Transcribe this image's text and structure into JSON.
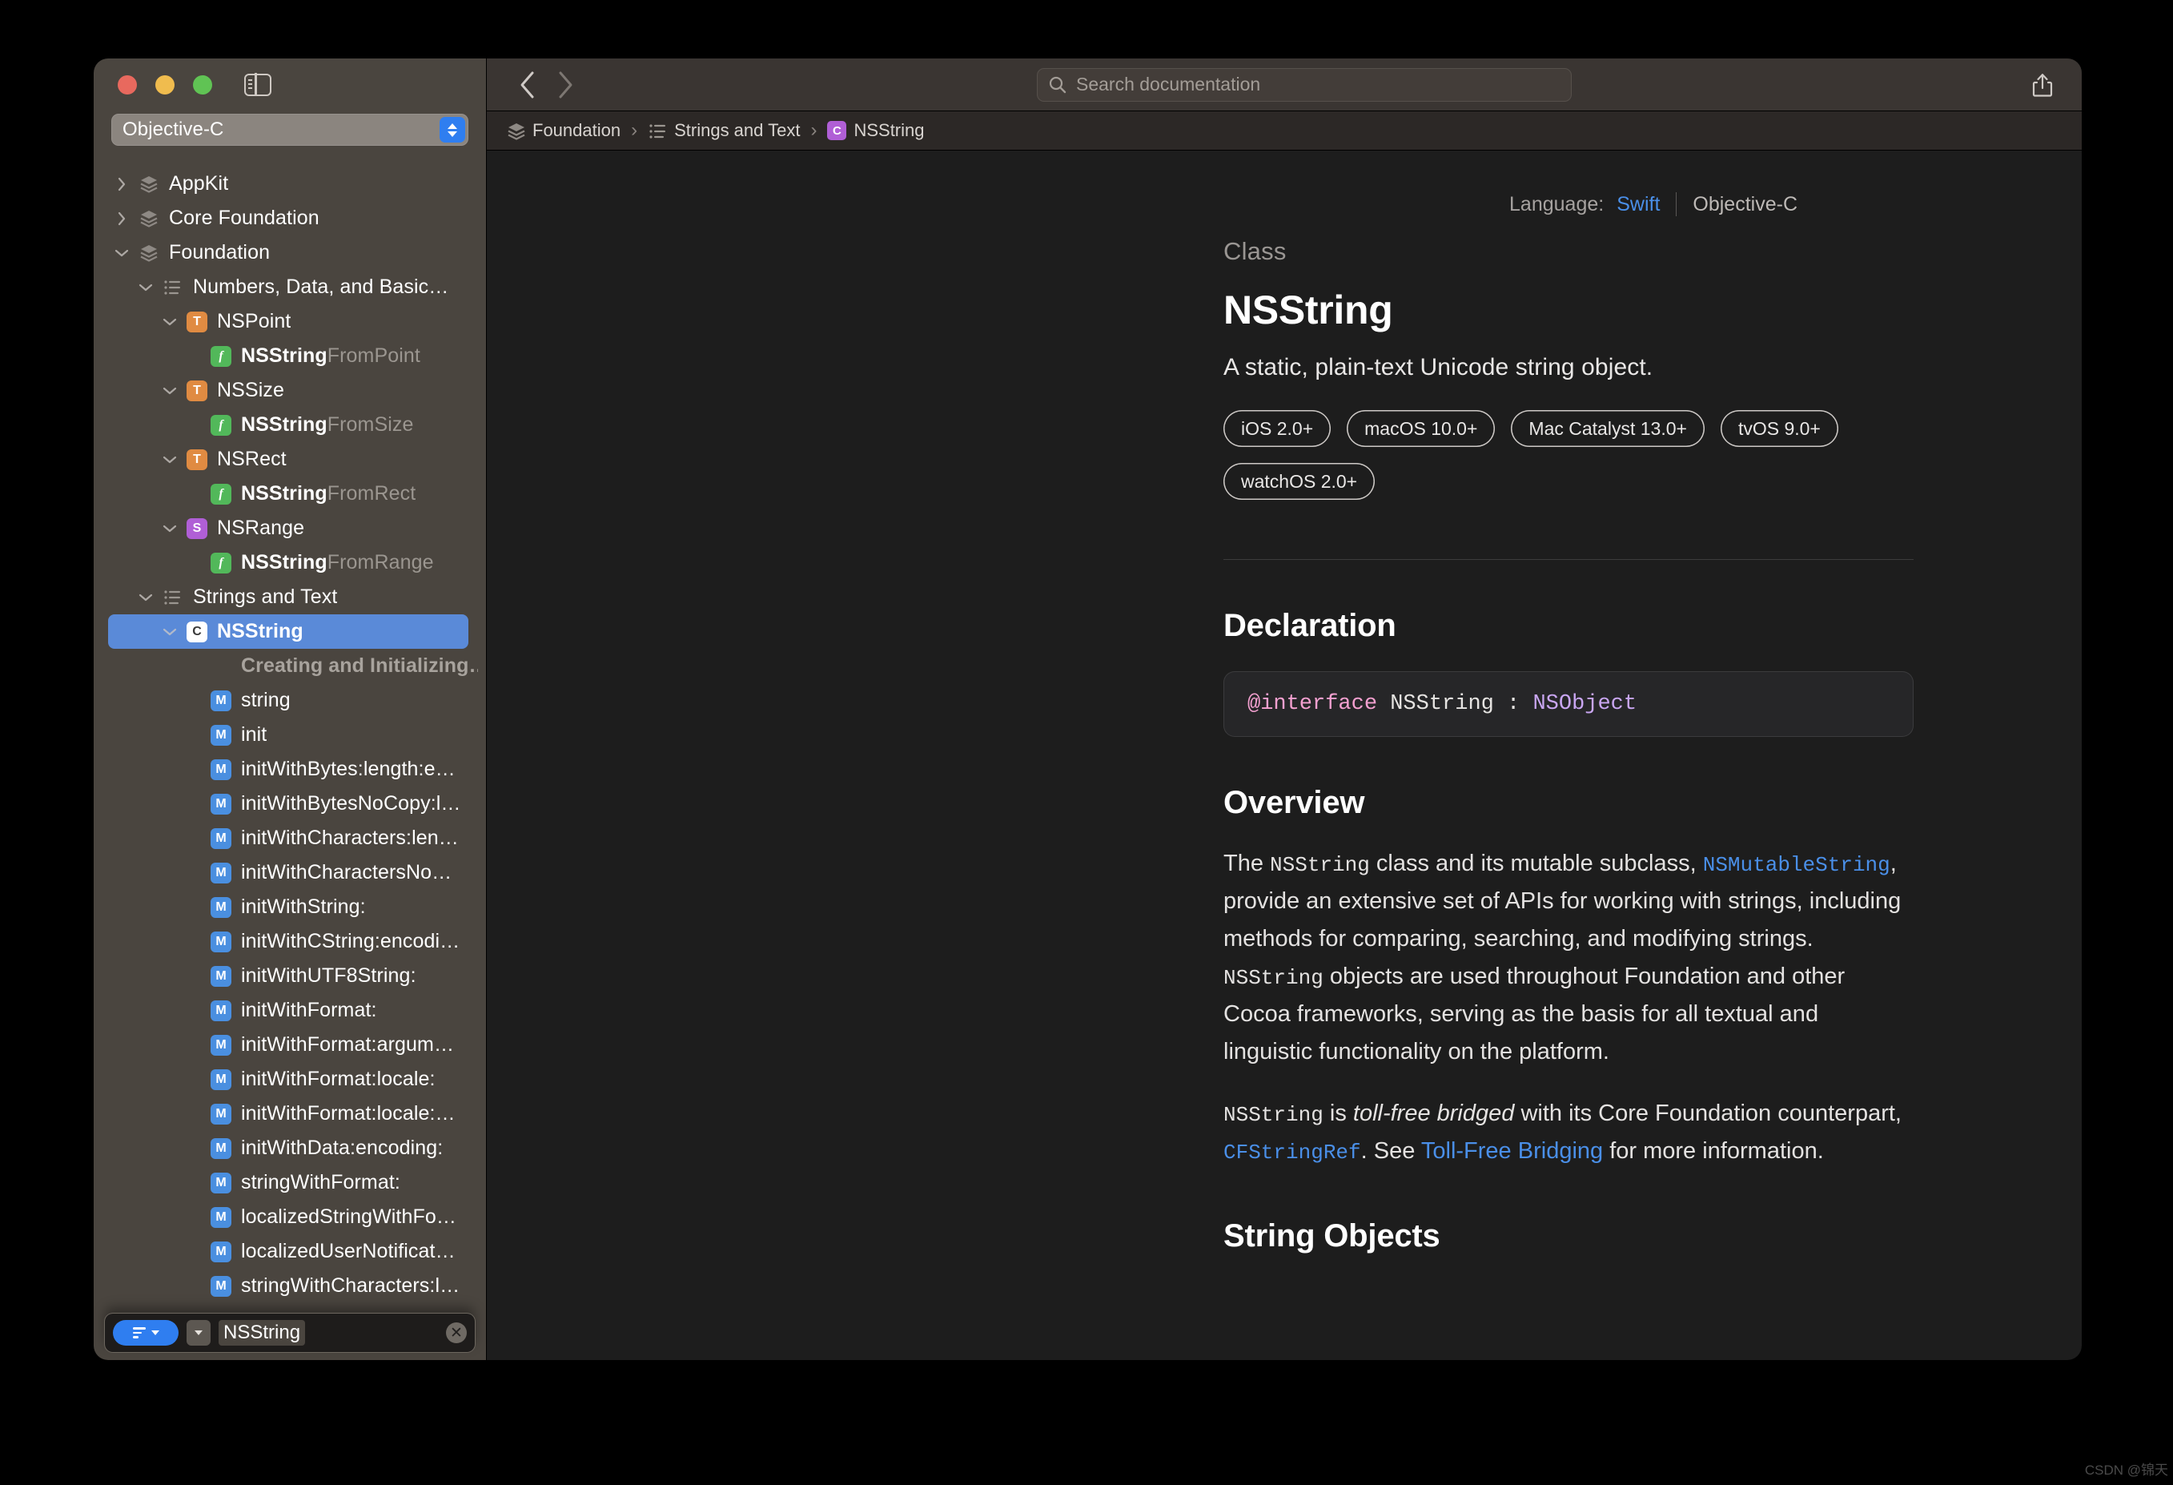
{
  "window": {
    "traffic_lights": [
      "close",
      "minimize",
      "zoom"
    ],
    "sidebar_toggle_icon": "sidebar-toggle-icon"
  },
  "sidebar": {
    "language_selector": {
      "value": "Objective-C"
    },
    "tree": [
      {
        "label": "AppKit",
        "icon": "framework-stack-icon",
        "disclosure": "collapsed",
        "indent": 0,
        "badge": "",
        "style": "plain"
      },
      {
        "label": "Core Foundation",
        "icon": "framework-stack-icon",
        "disclosure": "collapsed",
        "indent": 0,
        "badge": "",
        "style": "plain"
      },
      {
        "label": "Foundation",
        "icon": "framework-stack-icon",
        "disclosure": "expanded",
        "indent": 0,
        "badge": "",
        "style": "plain"
      },
      {
        "label": "Numbers, Data, and Basic…",
        "icon": "list-icon",
        "disclosure": "expanded",
        "indent": 1,
        "badge": "",
        "style": "plain"
      },
      {
        "label": "NSPoint",
        "icon": "",
        "disclosure": "expanded",
        "indent": 2,
        "badge": "T",
        "style": "plain"
      },
      {
        "label": "NSStringFromPoint",
        "bold_prefix": "NSString",
        "dim_suffix": "FromPoint",
        "icon": "",
        "disclosure": "none",
        "indent": 3,
        "badge": "F",
        "style": "split"
      },
      {
        "label": "NSSize",
        "icon": "",
        "disclosure": "expanded",
        "indent": 2,
        "badge": "T",
        "style": "plain"
      },
      {
        "label": "NSStringFromSize",
        "bold_prefix": "NSString",
        "dim_suffix": "FromSize",
        "icon": "",
        "disclosure": "none",
        "indent": 3,
        "badge": "F",
        "style": "split"
      },
      {
        "label": "NSRect",
        "icon": "",
        "disclosure": "expanded",
        "indent": 2,
        "badge": "T",
        "style": "plain"
      },
      {
        "label": "NSStringFromRect",
        "bold_prefix": "NSString",
        "dim_suffix": "FromRect",
        "icon": "",
        "disclosure": "none",
        "indent": 3,
        "badge": "F",
        "style": "split"
      },
      {
        "label": "NSRange",
        "icon": "",
        "disclosure": "expanded",
        "indent": 2,
        "badge": "S",
        "style": "plain"
      },
      {
        "label": "NSStringFromRange",
        "bold_prefix": "NSString",
        "dim_suffix": "FromRange",
        "icon": "",
        "disclosure": "none",
        "indent": 3,
        "badge": "F",
        "style": "split"
      },
      {
        "label": "Strings and Text",
        "icon": "list-icon",
        "disclosure": "expanded",
        "indent": 1,
        "badge": "",
        "style": "plain"
      },
      {
        "label": "NSString",
        "icon": "",
        "disclosure": "expanded",
        "indent": 2,
        "badge": "C",
        "style": "plain",
        "selected": true
      },
      {
        "label": "Creating and Initializing…",
        "icon": "",
        "disclosure": "none",
        "indent": 3,
        "badge": "",
        "style": "group"
      },
      {
        "label": "string",
        "icon": "",
        "disclosure": "none",
        "indent": 3,
        "badge": "M",
        "style": "plain"
      },
      {
        "label": "init",
        "icon": "",
        "disclosure": "none",
        "indent": 3,
        "badge": "M",
        "style": "plain"
      },
      {
        "label": "initWithBytes:length:e…",
        "icon": "",
        "disclosure": "none",
        "indent": 3,
        "badge": "M",
        "style": "plain"
      },
      {
        "label": "initWithBytesNoCopy:l…",
        "icon": "",
        "disclosure": "none",
        "indent": 3,
        "badge": "M",
        "style": "plain"
      },
      {
        "label": "initWithCharacters:len…",
        "icon": "",
        "disclosure": "none",
        "indent": 3,
        "badge": "M",
        "style": "plain"
      },
      {
        "label": "initWithCharactersNo…",
        "icon": "",
        "disclosure": "none",
        "indent": 3,
        "badge": "M",
        "style": "plain"
      },
      {
        "label": "initWithString:",
        "icon": "",
        "disclosure": "none",
        "indent": 3,
        "badge": "M",
        "style": "plain"
      },
      {
        "label": "initWithCString:encodi…",
        "icon": "",
        "disclosure": "none",
        "indent": 3,
        "badge": "M",
        "style": "plain"
      },
      {
        "label": "initWithUTF8String:",
        "icon": "",
        "disclosure": "none",
        "indent": 3,
        "badge": "M",
        "style": "plain"
      },
      {
        "label": "initWithFormat:",
        "icon": "",
        "disclosure": "none",
        "indent": 3,
        "badge": "M",
        "style": "plain"
      },
      {
        "label": "initWithFormat:argum…",
        "icon": "",
        "disclosure": "none",
        "indent": 3,
        "badge": "M",
        "style": "plain"
      },
      {
        "label": "initWithFormat:locale:",
        "icon": "",
        "disclosure": "none",
        "indent": 3,
        "badge": "M",
        "style": "plain"
      },
      {
        "label": "initWithFormat:locale:…",
        "icon": "",
        "disclosure": "none",
        "indent": 3,
        "badge": "M",
        "style": "plain"
      },
      {
        "label": "initWithData:encoding:",
        "icon": "",
        "disclosure": "none",
        "indent": 3,
        "badge": "M",
        "style": "plain"
      },
      {
        "label": "stringWithFormat:",
        "icon": "",
        "disclosure": "none",
        "indent": 3,
        "badge": "M",
        "style": "plain"
      },
      {
        "label": "localizedStringWithFo…",
        "icon": "",
        "disclosure": "none",
        "indent": 3,
        "badge": "M",
        "style": "plain"
      },
      {
        "label": "localizedUserNotificat…",
        "icon": "",
        "disclosure": "none",
        "indent": 3,
        "badge": "M",
        "style": "plain"
      },
      {
        "label": "stringWithCharacters:l…",
        "icon": "",
        "disclosure": "none",
        "indent": 3,
        "badge": "M",
        "style": "plain"
      }
    ],
    "filter_bar": {
      "filter_button_icon": "filter-lines-icon",
      "scope_chevron_icon": "chevron-down-icon",
      "token": "NSString",
      "clear_icon": "clear-circle-icon"
    }
  },
  "toolbar": {
    "back_icon": "chevron-left-icon",
    "forward_icon": "chevron-right-icon",
    "search": {
      "placeholder": "Search documentation",
      "icon": "search-icon"
    },
    "share_icon": "share-icon"
  },
  "breadcrumb": {
    "items": [
      {
        "label": "Foundation",
        "icon": "framework-stack-icon"
      },
      {
        "label": "Strings and Text",
        "icon": "list-icon"
      },
      {
        "label": "NSString",
        "icon": "class-badge",
        "badge": "C"
      }
    ],
    "separator": "›"
  },
  "document": {
    "language_row": {
      "label": "Language:",
      "swift": "Swift",
      "objc": "Objective-C"
    },
    "eyebrow": "Class",
    "title": "NSString",
    "abstract": "A static, plain-text Unicode string object.",
    "platforms": [
      "iOS 2.0+",
      "macOS 10.0+",
      "Mac Catalyst 13.0+",
      "tvOS 9.0+",
      "watchOS 2.0+"
    ],
    "declaration": {
      "heading": "Declaration",
      "keyword": "@interface",
      "identifier": " NSString : ",
      "type": "NSObject"
    },
    "overview": {
      "heading": "Overview",
      "p1_a": "The ",
      "p1_code1": "NSString",
      "p1_b": " class and its mutable subclass, ",
      "p1_link1": "NSMutableString",
      "p1_c": ", provide an extensive set of APIs for working with strings, including methods for comparing, searching, and modifying strings. ",
      "p1_code2": "NSString",
      "p1_d": " objects are used throughout Foundation and other Cocoa frameworks, serving as the basis for all textual and linguistic functionality on the platform.",
      "p2_code1": "NSString",
      "p2_a": " is ",
      "p2_em": "toll-free bridged",
      "p2_b": " with its Core Foundation counterpart, ",
      "p2_link1": "CFStringRef",
      "p2_c": ". See ",
      "p2_link2": "Toll-Free Bridging",
      "p2_d": " for more information."
    },
    "string_objects_heading": "String Objects"
  },
  "watermark": "CSDN @锦天",
  "colors": {
    "accent_blue": "#2f7ef0",
    "link_blue": "#4a8fe8",
    "selection_blue": "#5a8ad8",
    "badge_type": "#e08b42",
    "badge_struct": "#b05fd6",
    "badge_func": "#52b85a",
    "badge_method": "#4a8fe0",
    "sidebar_bg": "#4a453f",
    "content_bg": "#1d1d1d"
  }
}
